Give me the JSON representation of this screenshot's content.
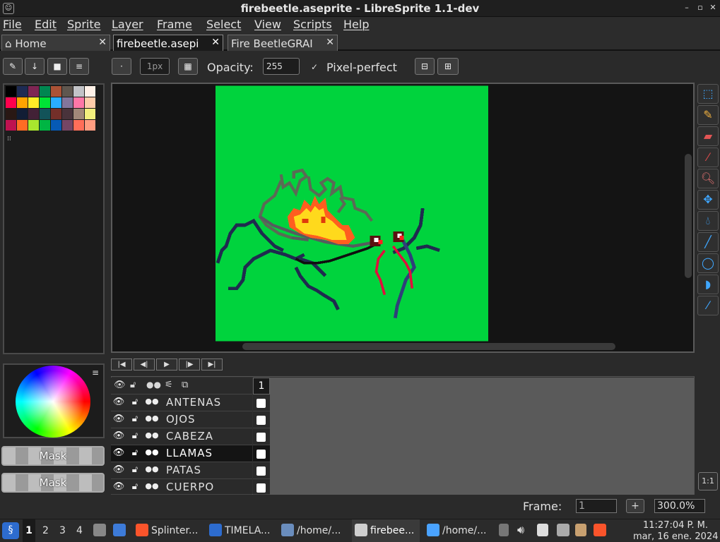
{
  "window": {
    "title": "firebeetle.aseprite - LibreSprite 1.1-dev",
    "icon": "libresprite-icon",
    "controls": [
      "minimize-icon",
      "maximize-icon",
      "close-icon"
    ]
  },
  "menu": [
    "File",
    "Edit",
    "Sprite",
    "Layer",
    "Frame",
    "Select",
    "View",
    "Scripts",
    "Help"
  ],
  "tabs": [
    {
      "label": "Home",
      "icon": "home-icon"
    },
    {
      "label": "firebeetle.asepi",
      "active": true
    },
    {
      "label": "Fire BeetleGRAI"
    }
  ],
  "toolbar": {
    "brush_size": "1px",
    "opacity_label": "Opacity:",
    "opacity_value": "255",
    "pixel_perfect_label": "Pixel-perfect",
    "pixel_perfect_checked": true
  },
  "palette_colors": [
    "#000000",
    "#1d2b53",
    "#7e2553",
    "#008751",
    "#ab5236",
    "#5f574f",
    "#c2c3c7",
    "#fff1e8",
    "#ff004d",
    "#ffa300",
    "#ffec27",
    "#00e436",
    "#29adff",
    "#83769c",
    "#ff77a8",
    "#ffccaa",
    "#291814",
    "#111d35",
    "#422136",
    "#125359",
    "#742f29",
    "#49333b",
    "#a28879",
    "#f3ef7d",
    "#be1250",
    "#ff6c24",
    "#a8e72e",
    "#00b543",
    "#065ab5",
    "#754665",
    "#ff6e59",
    "#ff9d81"
  ],
  "canvas": {
    "background": "#00d33d",
    "sprite_name": "Fire Beetle"
  },
  "tools": [
    "rectangle-marquee-icon",
    "pencil-icon",
    "eraser-icon",
    "eyedropper-icon",
    "zoom-icon",
    "move-icon",
    "paint-bucket-icon",
    "line-icon",
    "ellipse-icon",
    "contour-icon",
    "spray-icon"
  ],
  "masks": [
    "Mask",
    "Mask"
  ],
  "frame_nav": [
    "first-frame-icon",
    "prev-frame-icon",
    "play-icon",
    "next-frame-icon",
    "last-frame-icon"
  ],
  "timeline": {
    "frame_header": "1",
    "layers": [
      {
        "name": "ANTENAS",
        "selected": false
      },
      {
        "name": "OJOS",
        "selected": false
      },
      {
        "name": "CABEZA",
        "selected": false
      },
      {
        "name": "LLAMAS",
        "selected": true
      },
      {
        "name": "PATAS",
        "selected": false
      },
      {
        "name": "CUERPO",
        "selected": false
      }
    ]
  },
  "status": {
    "frame_label": "Frame:",
    "frame_value": "1",
    "zoom": "300.0%"
  },
  "zoom_reset": "1:1",
  "taskbar": {
    "workspaces": [
      "1",
      "2",
      "3",
      "4"
    ],
    "items": [
      "Splinter...",
      "TIMELA...",
      "/home/...",
      "firebee...",
      "/home/..."
    ],
    "time": "11:27:04 P. M.",
    "date": "mar, 16 ene. 2024"
  }
}
